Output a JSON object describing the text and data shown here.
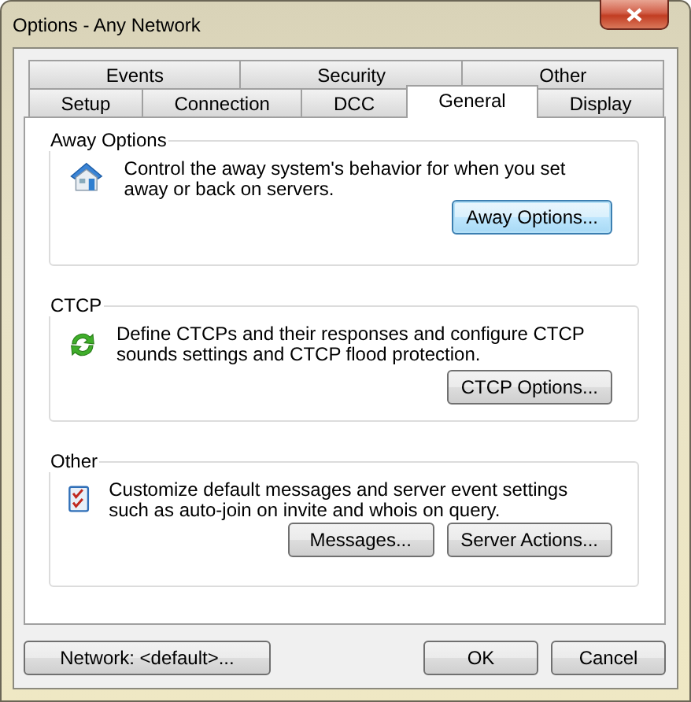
{
  "window": {
    "title": "Options - Any Network"
  },
  "tab_rows": [
    [
      {
        "label": "Events",
        "selected": false
      },
      {
        "label": "Security",
        "selected": false
      },
      {
        "label": "Other",
        "selected": false
      }
    ],
    [
      {
        "label": "Setup",
        "selected": false
      },
      {
        "label": "Connection",
        "selected": false
      },
      {
        "label": "DCC",
        "selected": false
      },
      {
        "label": "General",
        "selected": true
      },
      {
        "label": "Display",
        "selected": false
      }
    ]
  ],
  "groups": [
    {
      "title": "Away Options",
      "kind": "house",
      "description": "Control the away system's behavior for when you set away or back on servers.",
      "buttons": [
        {
          "label": "Away Options...",
          "focused": true
        }
      ]
    },
    {
      "title": "CTCP",
      "kind": "refresh",
      "description": "Define CTCPs and their responses and configure CTCP sounds settings and CTCP flood protection.",
      "buttons": [
        {
          "label": "CTCP Options...",
          "focused": false
        }
      ]
    },
    {
      "title": "Other",
      "kind": "checklist",
      "description": "Customize default messages and server event settings such as auto-join on invite and whois on query.",
      "buttons": [
        {
          "label": "Messages...",
          "focused": false
        },
        {
          "label": "Server Actions...",
          "focused": false
        }
      ]
    }
  ],
  "footer": {
    "left": [
      {
        "label": "Network: <default>...",
        "focused": false
      }
    ],
    "right": [
      {
        "label": "OK",
        "focused": false
      },
      {
        "label": "Cancel",
        "focused": false
      }
    ]
  }
}
